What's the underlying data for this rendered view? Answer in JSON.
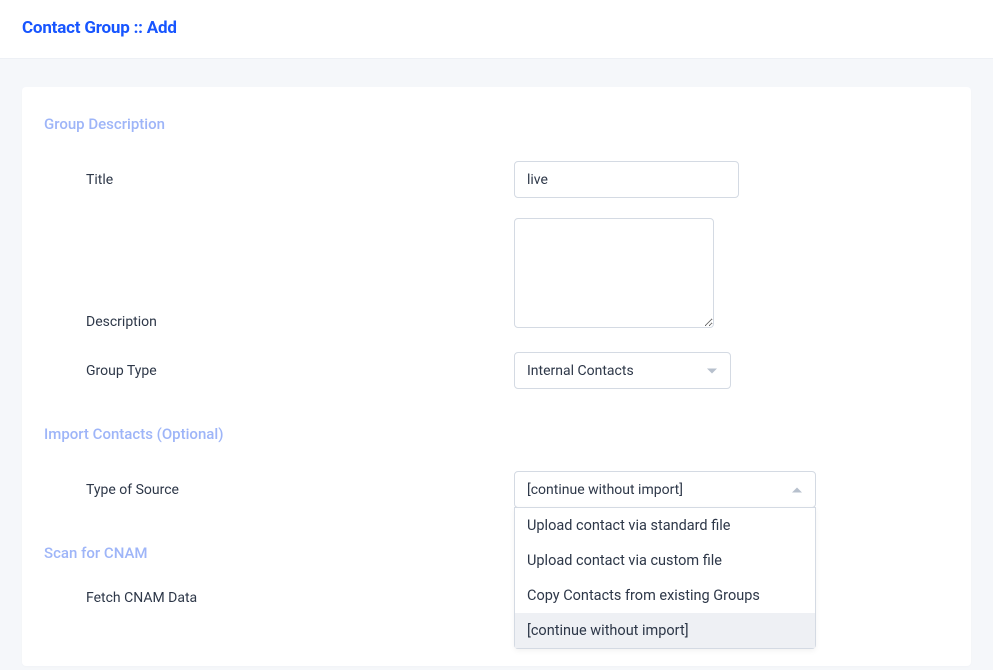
{
  "header": {
    "title": "Contact Group :: Add"
  },
  "sections": {
    "group_description": {
      "heading": "Group Description",
      "title_label": "Title",
      "title_value": "live",
      "description_label": "Description",
      "description_value": "",
      "group_type_label": "Group Type",
      "group_type_selected": "Internal Contacts"
    },
    "import_contacts": {
      "heading": "Import Contacts (Optional)",
      "source_label": "Type of Source",
      "source_selected": "[continue without import]",
      "source_options": [
        "Upload contact via standard file",
        "Upload contact via custom file",
        "Copy Contacts from existing Groups",
        "[continue without import]"
      ]
    },
    "scan_cnam": {
      "heading": "Scan for CNAM",
      "fetch_label": "Fetch CNAM Data"
    }
  }
}
